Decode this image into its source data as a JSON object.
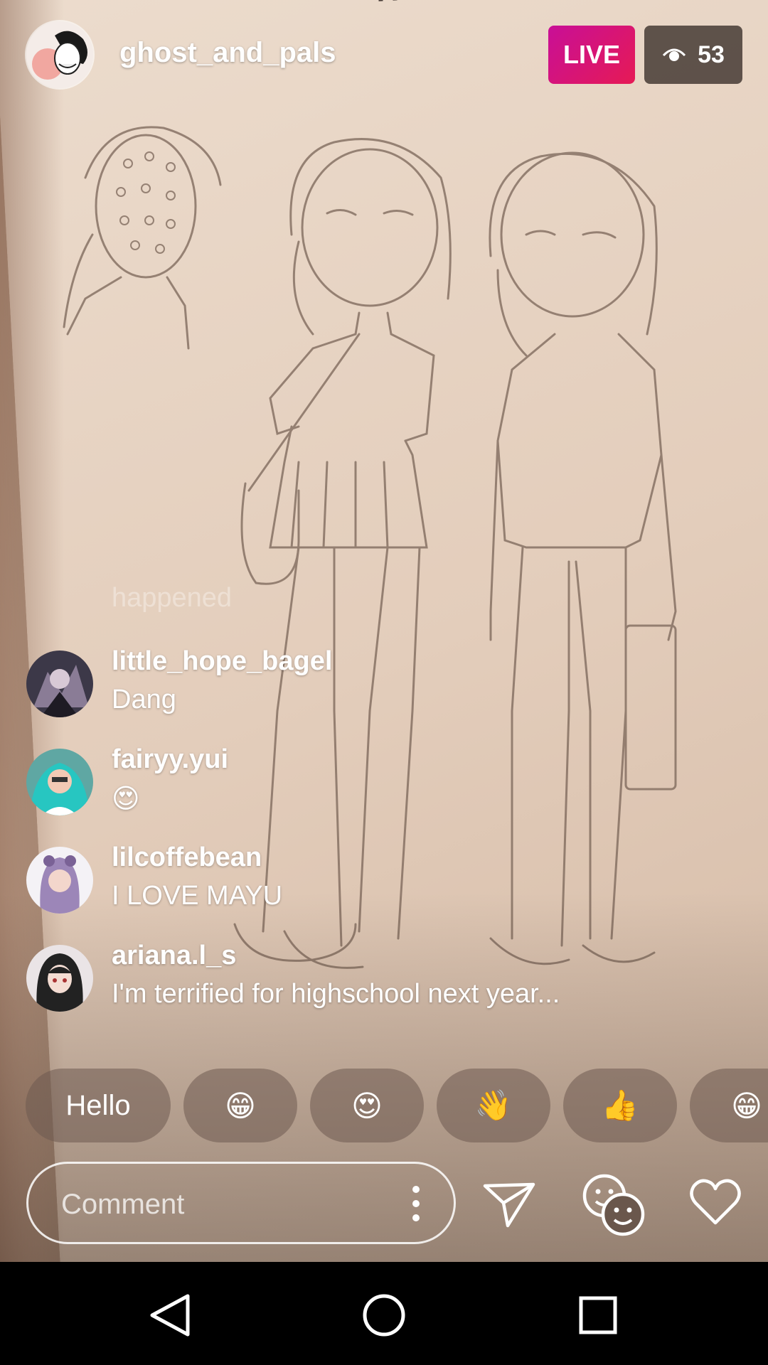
{
  "header": {
    "host_username": "ghost_and_pals",
    "live_label": "LIVE",
    "viewer_count": "53"
  },
  "comments": {
    "faded_previous": "happened",
    "items": [
      {
        "username": "little_hope_bagel",
        "text": "Dang"
      },
      {
        "username": "fairyy.yui",
        "text": "😍"
      },
      {
        "username": "lilcoffebean",
        "text": "I LOVE MAYU"
      },
      {
        "username": "ariana.l_s",
        "text": "I'm terrified for highschool next year..."
      }
    ]
  },
  "quick_replies": [
    "Hello",
    "😁",
    "😍",
    "👋",
    "👍",
    "😁"
  ],
  "composer": {
    "placeholder": "Comment"
  },
  "icons": {
    "viewers": "eye-icon",
    "more": "more-vertical-icon",
    "send": "send-icon",
    "guests": "invite-guests-icon",
    "like": "heart-icon",
    "nav_back": "back-triangle-icon",
    "nav_home": "home-circle-icon",
    "nav_recents": "recents-square-icon"
  },
  "colors": {
    "live_gradient_start": "#c80f97",
    "live_gradient_end": "#e61a55"
  }
}
